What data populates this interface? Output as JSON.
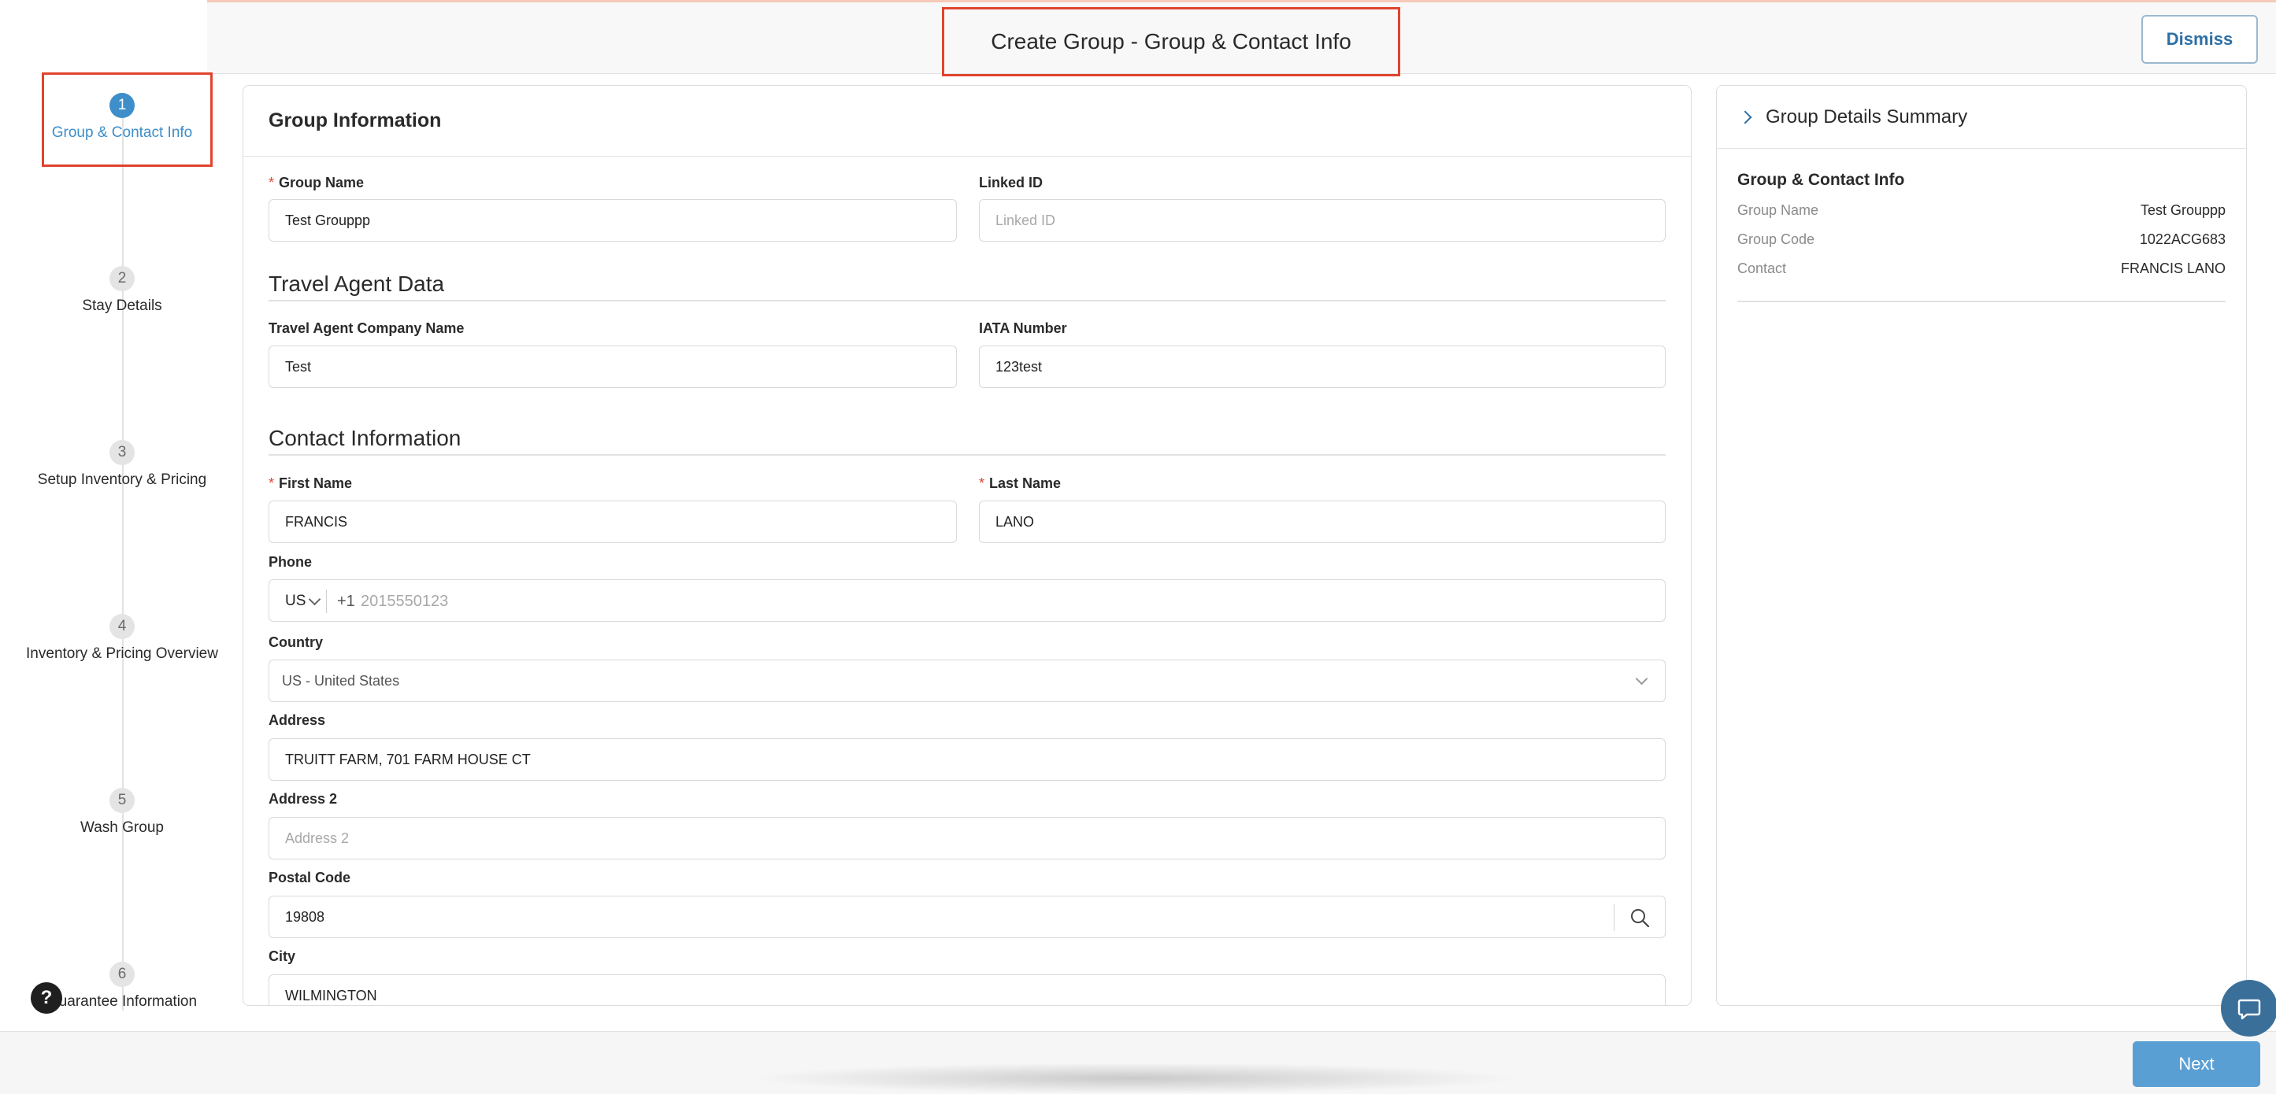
{
  "header": {
    "title": "Create Group - Group & Contact Info",
    "dismiss_label": "Dismiss"
  },
  "steps": [
    {
      "number": "1",
      "label": "Group & Contact Info",
      "active": true
    },
    {
      "number": "2",
      "label": "Stay Details"
    },
    {
      "number": "3",
      "label": "Setup Inventory & Pricing"
    },
    {
      "number": "4",
      "label": "Inventory & Pricing Overview"
    },
    {
      "number": "5",
      "label": "Wash Group"
    },
    {
      "number": "6",
      "label": "Guarantee Information"
    }
  ],
  "form": {
    "panel_title": "Group Information",
    "group_name": {
      "label": "Group Name",
      "value": "Test Grouppp"
    },
    "linked_id": {
      "label": "Linked ID",
      "placeholder": "Linked ID"
    },
    "travel_section_title": "Travel Agent Data",
    "travel_company": {
      "label": "Travel Agent Company Name",
      "value": "Test"
    },
    "iata": {
      "label": "IATA Number",
      "value": "123test"
    },
    "contact_section_title": "Contact Information",
    "first_name": {
      "label": "First Name",
      "value": "FRANCIS"
    },
    "last_name": {
      "label": "Last Name",
      "value": "LANO"
    },
    "phone": {
      "label": "Phone",
      "country": "US",
      "prefix": "+1",
      "placeholder": "2015550123"
    },
    "country": {
      "label": "Country",
      "value": "US - United States"
    },
    "address": {
      "label": "Address",
      "value": "TRUITT FARM, 701 FARM HOUSE CT"
    },
    "address2": {
      "label": "Address 2",
      "placeholder": "Address 2"
    },
    "postal": {
      "label": "Postal Code",
      "value": "19808"
    },
    "city": {
      "label": "City",
      "value": "WILMINGTON"
    }
  },
  "summary": {
    "title": "Group Details Summary",
    "section_title": "Group & Contact Info",
    "rows": [
      {
        "key": "Group Name",
        "value": "Test Grouppp"
      },
      {
        "key": "Group Code",
        "value": "1022ACG683"
      },
      {
        "key": "Contact",
        "value": "FRANCIS LANO"
      }
    ]
  },
  "footer": {
    "next_label": "Next",
    "help_label": "?"
  },
  "colors": {
    "accent": "#3d8ec9",
    "highlight": "#e0442e",
    "button": "#5a9fd4"
  }
}
